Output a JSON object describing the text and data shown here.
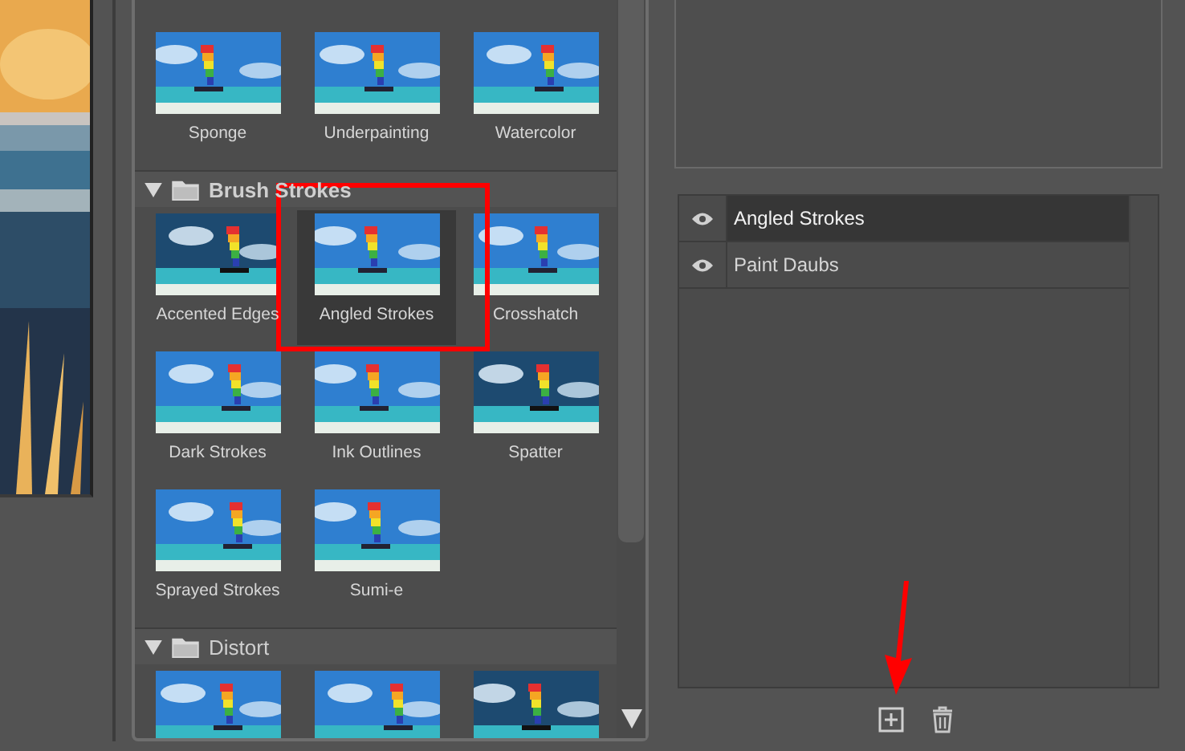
{
  "gallery": {
    "sections": [
      {
        "items": [
          {
            "label": "Sponge",
            "selected": false
          },
          {
            "label": "Underpainting",
            "selected": false
          },
          {
            "label": "Watercolor",
            "selected": false
          }
        ]
      },
      {
        "title": "Brush Strokes",
        "expanded": true,
        "items": [
          {
            "label": "Accented Edges",
            "selected": false
          },
          {
            "label": "Angled Strokes",
            "selected": true
          },
          {
            "label": "Crosshatch",
            "selected": false
          },
          {
            "label": "Dark Strokes",
            "selected": false
          },
          {
            "label": "Ink Outlines",
            "selected": false
          },
          {
            "label": "Spatter",
            "selected": false
          },
          {
            "label": "Sprayed Strokes",
            "selected": false
          },
          {
            "label": "Sumi-e",
            "selected": false
          }
        ]
      },
      {
        "title": "Distort",
        "expanded": true,
        "items": [
          {
            "selected": false
          },
          {
            "selected": false
          },
          {
            "selected": false
          }
        ]
      }
    ]
  },
  "layers": [
    {
      "name": "Angled Strokes",
      "visible": true,
      "selected": true
    },
    {
      "name": "Paint Daubs",
      "visible": true,
      "selected": false
    }
  ]
}
